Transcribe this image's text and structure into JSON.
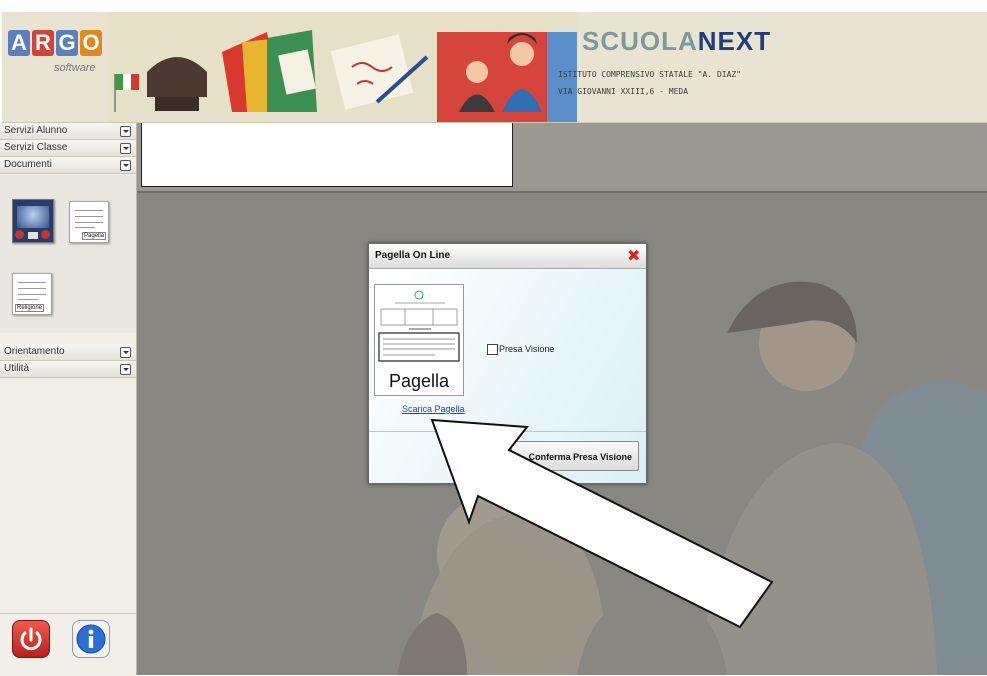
{
  "header": {
    "logo_letters": [
      "A",
      "R",
      "G",
      "O"
    ],
    "logo_colors": [
      "#5a7fbf",
      "#d0453a",
      "#5a7fbf",
      "#e08a1c"
    ],
    "logo_subtitle": "software",
    "brand_part1": "SCUOLA",
    "brand_part2": "NEXT",
    "school_name": "ISTITUTO COMPRENSIVO STATALE \"A. DIAZ\"",
    "school_address": "VIA GIOVANNI XXIII,6 - MEDA"
  },
  "sidebar": {
    "items": [
      {
        "label": "Servizi Alunno"
      },
      {
        "label": "Servizi Classe"
      },
      {
        "label": "Documenti"
      },
      {
        "label": "Orientamento"
      },
      {
        "label": "Utilità"
      }
    ],
    "doc_icons": [
      {
        "name": "bacheca",
        "caption": ""
      },
      {
        "name": "pagella",
        "caption": "Pagella"
      },
      {
        "name": "religione",
        "caption": "Religione"
      }
    ],
    "bottom_buttons": [
      "power-icon",
      "info-icon"
    ]
  },
  "dialog": {
    "title": "Pagella On Line",
    "thumbnail_label": "Pagella",
    "checkbox_label": "Presa Visione",
    "checkbox_checked": false,
    "download_link": "Scarica Pagella",
    "confirm_button": "Conferma Presa Visione"
  },
  "colors": {
    "main_background": "#898782",
    "close_icon": "#d22222",
    "link": "#1a3edc",
    "brand_dark": "#1f3f7a"
  }
}
